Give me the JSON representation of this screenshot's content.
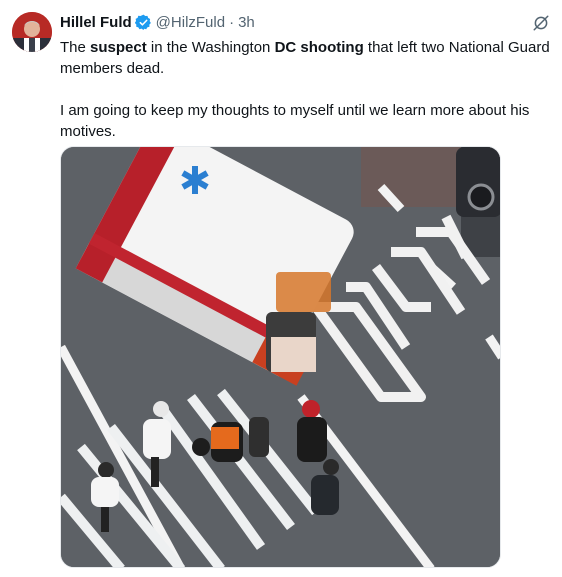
{
  "tweet": {
    "author_name": "Hillel Fuld",
    "handle": "@HilzFuld",
    "separator": "·",
    "time": "3h",
    "text_line1": {
      "part1": "The ",
      "bold1": "suspect",
      "part2": " in the Washington ",
      "bold2": "DC shooting",
      "part3": " that left two National Guard members dead."
    },
    "text_line2": "I am going to keep my thoughts to myself until we learn more about his motives."
  },
  "icons": {
    "verified": "verified-badge-icon",
    "grok": "grok-icon",
    "medical_star": "star-of-life-icon"
  },
  "colors": {
    "brand_blue": "#1d9bf0",
    "secondary_text": "#536471",
    "primary_text": "#0f1419"
  }
}
